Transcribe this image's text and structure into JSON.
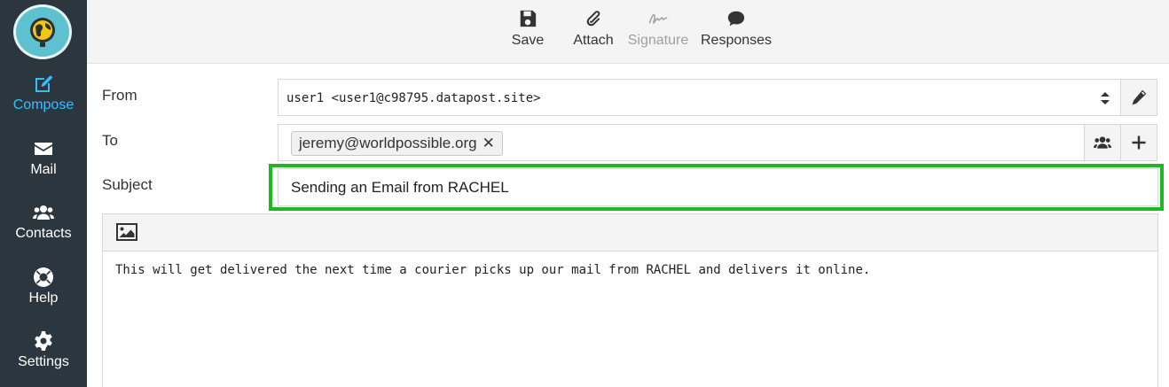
{
  "sidebar": {
    "items": [
      {
        "label": "Compose",
        "icon": "edit-icon",
        "active": true
      },
      {
        "label": "Mail",
        "icon": "envelope-icon"
      },
      {
        "label": "Contacts",
        "icon": "users-icon"
      },
      {
        "label": "Help",
        "icon": "lifebuoy-icon"
      },
      {
        "label": "Settings",
        "icon": "gear-icon"
      }
    ],
    "accent_color": "#37beff",
    "background_color": "#2c363f"
  },
  "toolbar": {
    "save_label": "Save",
    "attach_label": "Attach",
    "signature_label": "Signature",
    "responses_label": "Responses"
  },
  "form": {
    "from_label": "From",
    "from_value": "user1 <user1@c98795.datapost.site>",
    "to_label": "To",
    "recipient": "jeremy@worldpossible.org",
    "remove_symbol": "✕",
    "subject_label": "Subject",
    "subject_value": "Sending an Email from RACHEL",
    "highlight_color": "#1eb91e"
  },
  "editor": {
    "body": "This will get delivered the next time a courier picks up our mail from RACHEL and delivers it online."
  }
}
